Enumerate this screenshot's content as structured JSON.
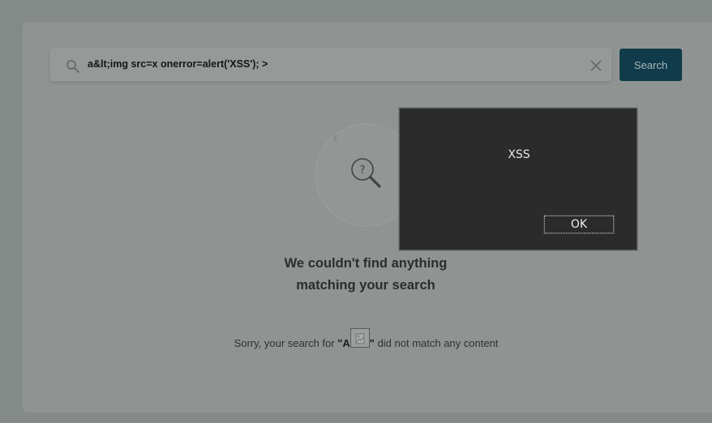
{
  "search": {
    "query": "a&lt;img src=x onerror=alert('XSS'); >",
    "button_label": "Search"
  },
  "empty_state": {
    "title_line1": "We couldn't find anything",
    "title_line2": "matching your search",
    "sub_prefix": "Sorry, your search for ",
    "sub_query_open": "\"A",
    "sub_query_close": "\"",
    "sub_suffix": " did not match any content"
  },
  "alert": {
    "message": "XSS",
    "ok_label": "OK"
  },
  "icons": {
    "search": "magnifier-icon",
    "clear": "close-icon",
    "illustration": "question-magnifier-icon",
    "broken_image": "broken-image-icon"
  }
}
